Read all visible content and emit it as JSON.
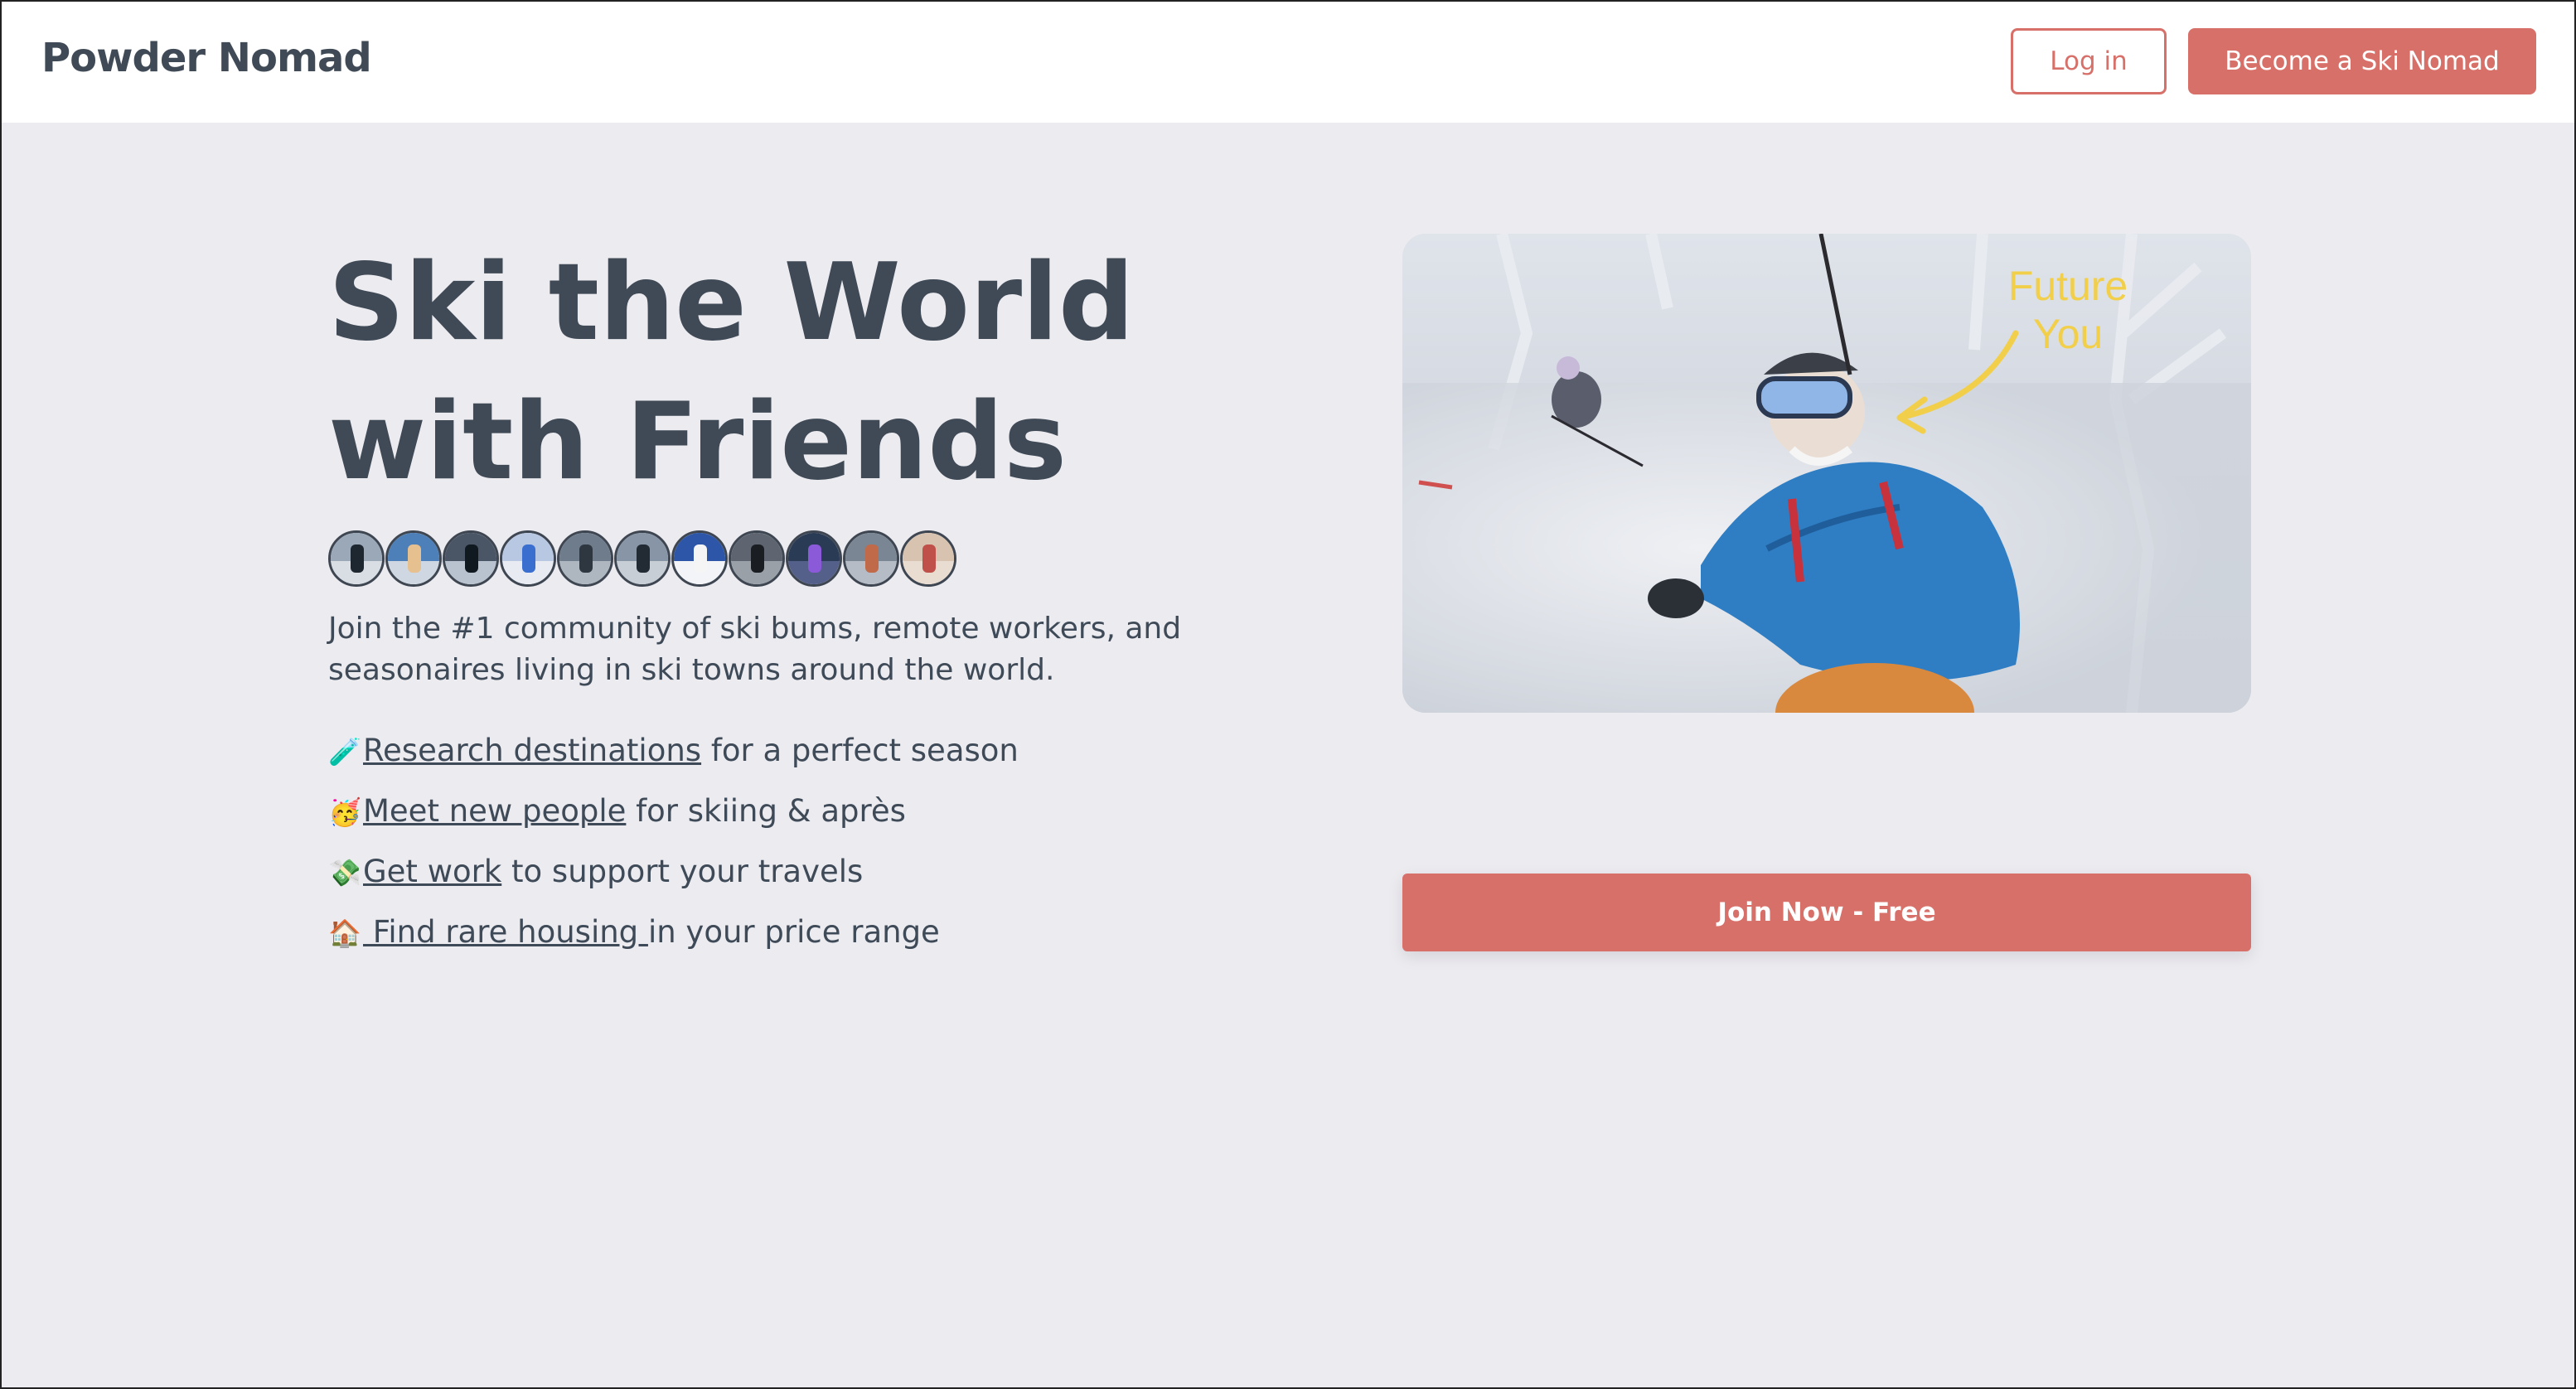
{
  "header": {
    "brand": "Powder Nomad",
    "login_label": "Log in",
    "signup_label": "Become a Ski Nomad"
  },
  "hero": {
    "title_line1": "Ski the World",
    "title_line2": "with Friends",
    "intro": "Join the #1 community of ski bums, remote workers, and seasonaires living in ski towns around the world.",
    "features": [
      {
        "emoji": "🧪",
        "link": "Research destinations",
        "rest": " for a perfect season"
      },
      {
        "emoji": "🥳",
        "link": "Meet new people",
        "rest": " for skiing & après"
      },
      {
        "emoji": "💸",
        "link": "Get work",
        "rest": " to support your travels"
      },
      {
        "emoji": "🏠",
        "link": " Find rare housing ",
        "rest": " in your price range"
      }
    ],
    "photo_annotation_line1": "Future",
    "photo_annotation_line2": "You",
    "cta_label": "Join Now - Free"
  },
  "colors": {
    "accent": "#d8706a",
    "text": "#3f4a56",
    "background": "#ecebf0"
  },
  "avatars": [
    {
      "name": "member-1"
    },
    {
      "name": "member-2"
    },
    {
      "name": "member-3"
    },
    {
      "name": "member-4"
    },
    {
      "name": "member-5"
    },
    {
      "name": "member-6"
    },
    {
      "name": "member-7"
    },
    {
      "name": "member-8"
    },
    {
      "name": "member-9"
    },
    {
      "name": "member-10"
    },
    {
      "name": "member-11"
    }
  ]
}
